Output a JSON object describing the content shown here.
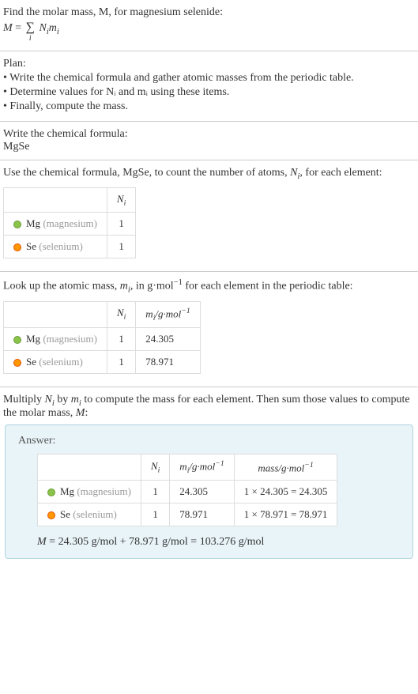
{
  "header": {
    "prompt": "Find the molar mass, M, for magnesium selenide:",
    "formula_lhs": "M",
    "formula_rhs_var1": "N",
    "formula_rhs_var2": "m",
    "sum_index": "i"
  },
  "plan": {
    "title": "Plan:",
    "items": [
      "• Write the chemical formula and gather atomic masses from the periodic table.",
      "• Determine values for Nᵢ and mᵢ using these items.",
      "• Finally, compute the mass."
    ]
  },
  "step_formula": {
    "title": "Write the chemical formula:",
    "formula": "MgSe"
  },
  "step_count": {
    "intro_a": "Use the chemical formula, MgSe, to count the number of atoms, ",
    "intro_var": "N",
    "intro_sub": "i",
    "intro_b": ", for each element:",
    "col_n": "N",
    "col_n_sub": "i",
    "rows": [
      {
        "sym": "Mg",
        "name": "(magnesium)",
        "n": "1",
        "bullet": "bullet-mg"
      },
      {
        "sym": "Se",
        "name": "(selenium)",
        "n": "1",
        "bullet": "bullet-se"
      }
    ]
  },
  "step_lookup": {
    "intro_a": "Look up the atomic mass, ",
    "intro_var": "m",
    "intro_sub": "i",
    "intro_b": ", in g·mol",
    "intro_sup": "−1",
    "intro_c": " for each element in the periodic table:",
    "col_n": "N",
    "col_n_sub": "i",
    "col_m": "m",
    "col_m_sub": "i",
    "col_m_unit": "/g·mol",
    "col_m_sup": "−1",
    "rows": [
      {
        "sym": "Mg",
        "name": "(magnesium)",
        "n": "1",
        "m": "24.305",
        "bullet": "bullet-mg"
      },
      {
        "sym": "Se",
        "name": "(selenium)",
        "n": "1",
        "m": "78.971",
        "bullet": "bullet-se"
      }
    ]
  },
  "step_multiply": {
    "intro_a": "Multiply ",
    "var1": "N",
    "sub1": "i",
    "intro_b": " by ",
    "var2": "m",
    "sub2": "i",
    "intro_c": " to compute the mass for each element. Then sum those values to compute the molar mass, ",
    "var3": "M",
    "intro_d": ":"
  },
  "answer": {
    "label": "Answer:",
    "col_n": "N",
    "col_n_sub": "i",
    "col_m": "m",
    "col_m_sub": "i",
    "col_m_unit": "/g·mol",
    "col_m_sup": "−1",
    "col_mass": "mass/g·mol",
    "col_mass_sup": "−1",
    "rows": [
      {
        "sym": "Mg",
        "name": "(magnesium)",
        "n": "1",
        "m": "24.305",
        "mass": "1 × 24.305 = 24.305",
        "bullet": "bullet-mg"
      },
      {
        "sym": "Se",
        "name": "(selenium)",
        "n": "1",
        "m": "78.971",
        "mass": "1 × 78.971 = 78.971",
        "bullet": "bullet-se"
      }
    ],
    "result_var": "M",
    "result": " = 24.305 g/mol + 78.971 g/mol = 103.276 g/mol"
  }
}
